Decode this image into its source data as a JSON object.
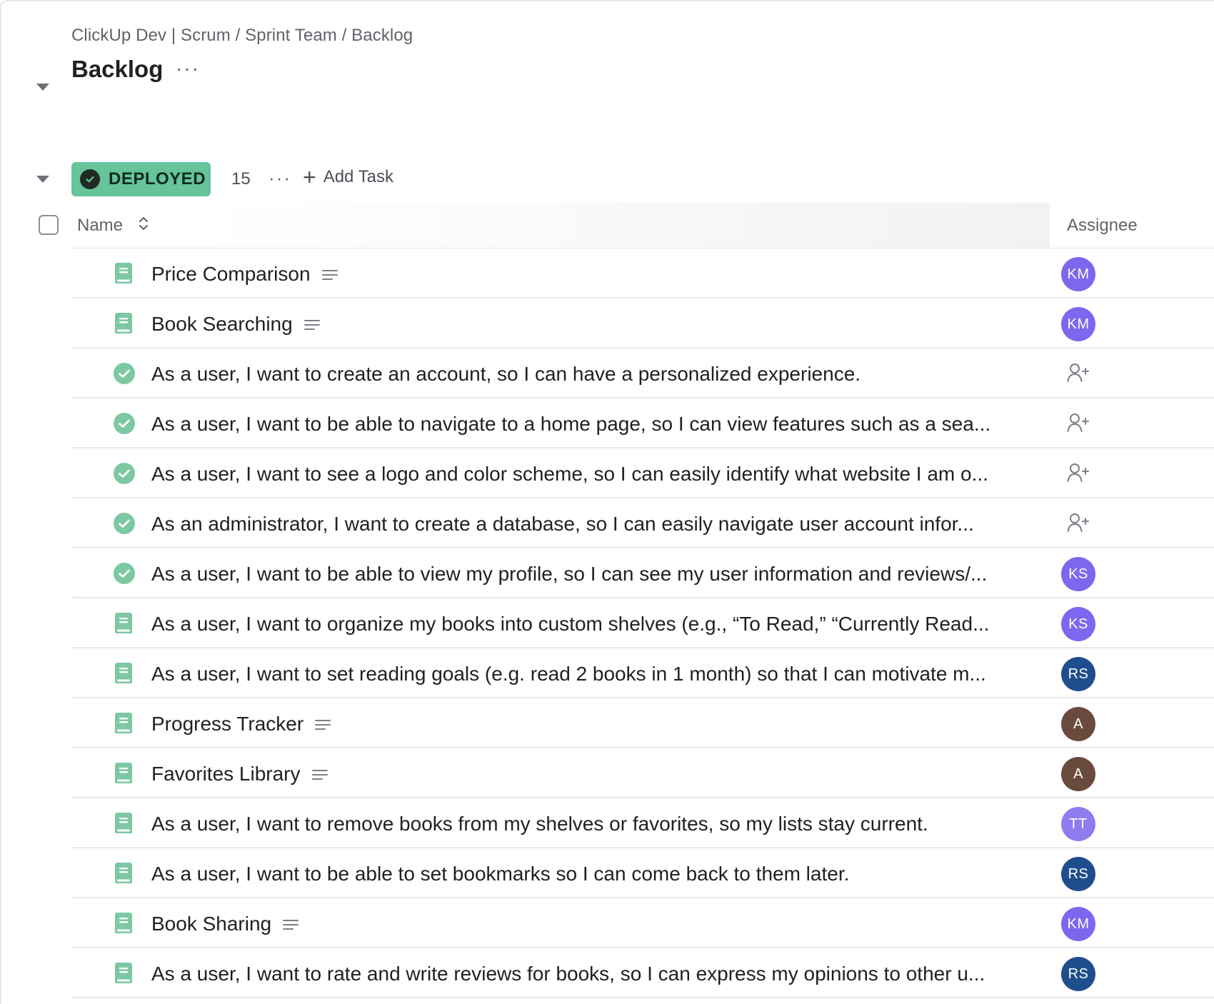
{
  "breadcrumb": "ClickUp Dev | Scrum / Sprint Team / Backlog",
  "title": "Backlog",
  "more_label": "···",
  "group": {
    "status": "DEPLOYED",
    "count": "15",
    "more_label": "···",
    "add_task": "Add Task",
    "status_color": "#67c39a"
  },
  "columns": {
    "name": "Name",
    "assignee": "Assignee"
  },
  "colors": {
    "KM": "#7b68ee",
    "KS": "#7b68ee",
    "RS": "#1f4e8c",
    "A": "#6b4a3e",
    "TT": "#8e7cf0",
    "task_icon": "#7cc8a2",
    "done_icon": "#7cc8a2"
  },
  "tasks": [
    {
      "name": "Price Comparison",
      "icon": "book-icon",
      "has_desc": true,
      "assignee": "KM"
    },
    {
      "name": "Book Searching",
      "icon": "book-icon",
      "has_desc": true,
      "assignee": "KM"
    },
    {
      "name": "As a user, I want to create an account, so I can have a personalized experience.",
      "icon": "check-circle-icon",
      "has_desc": false,
      "assignee": ""
    },
    {
      "name": "As a user, I want to be able to navigate to a home page, so I can view features such as a sea...",
      "icon": "check-circle-icon",
      "has_desc": false,
      "assignee": ""
    },
    {
      "name": "As a user, I want to see a logo and color scheme, so I can easily identify what website I am o...",
      "icon": "check-circle-icon",
      "has_desc": false,
      "assignee": ""
    },
    {
      "name": "As an administrator, I want to create a database, so I can easily navigate user account infor...",
      "icon": "check-circle-icon",
      "has_desc": false,
      "assignee": ""
    },
    {
      "name": "As a user, I want to be able to view my profile, so I can see my user information and reviews/...",
      "icon": "check-circle-icon",
      "has_desc": false,
      "assignee": "KS"
    },
    {
      "name": "As a user, I want to organize my books into custom shelves (e.g., “To Read,” “Currently Read...",
      "icon": "book-icon",
      "has_desc": false,
      "assignee": "KS"
    },
    {
      "name": "As a user, I want to set reading goals (e.g. read 2 books in 1 month) so that I can motivate m...",
      "icon": "book-icon",
      "has_desc": false,
      "assignee": "RS"
    },
    {
      "name": "Progress Tracker",
      "icon": "book-icon",
      "has_desc": true,
      "assignee": "A"
    },
    {
      "name": "Favorites Library",
      "icon": "book-icon",
      "has_desc": true,
      "assignee": "A"
    },
    {
      "name": "As a user, I want to remove books from my shelves or favorites, so my lists stay current.",
      "icon": "book-icon",
      "has_desc": false,
      "assignee": "TT"
    },
    {
      "name": "As a user, I want to be able to set bookmarks so I can come back to them later.",
      "icon": "book-icon",
      "has_desc": false,
      "assignee": "RS"
    },
    {
      "name": "Book Sharing",
      "icon": "book-icon",
      "has_desc": true,
      "assignee": "KM"
    },
    {
      "name": "As a user, I want to rate and write reviews for books, so I can express my opinions to other u...",
      "icon": "book-icon",
      "has_desc": false,
      "assignee": "RS"
    }
  ]
}
